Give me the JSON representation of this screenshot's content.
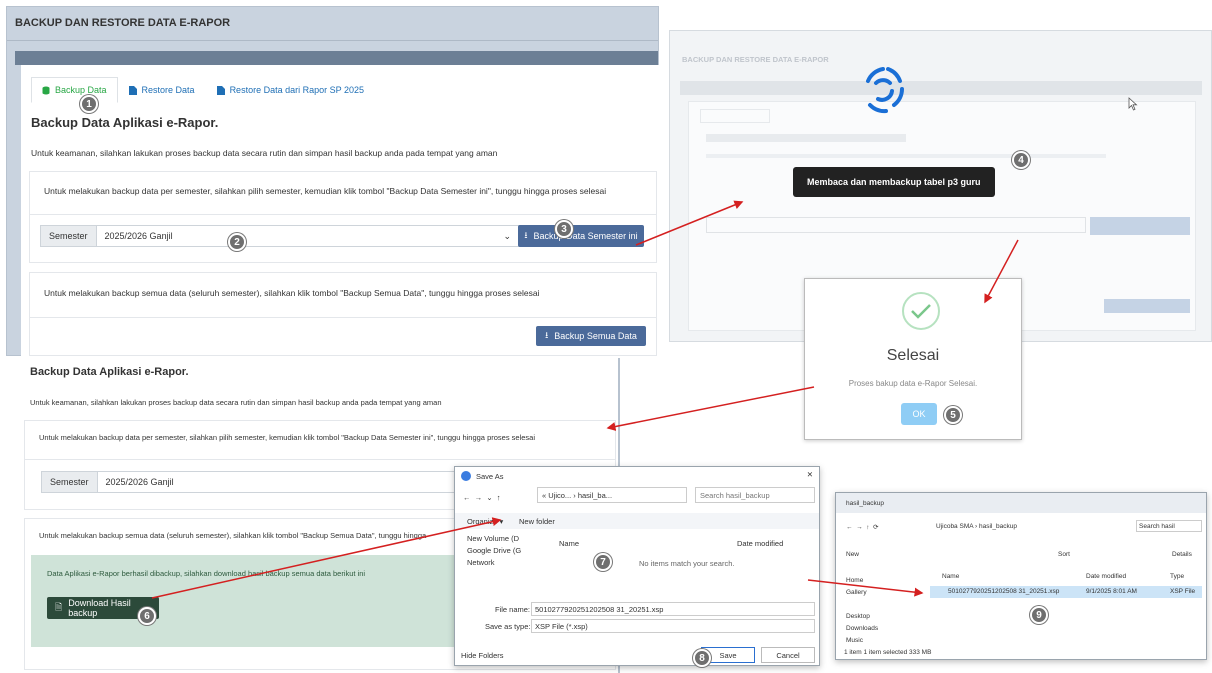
{
  "panel1": {
    "header": "BACKUP DAN RESTORE DATA E-RAPOR",
    "tabs": [
      {
        "label": "Backup Data"
      },
      {
        "label": "Restore Data"
      },
      {
        "label": "Restore Data dari Rapor SP 2025"
      }
    ],
    "title": "Backup Data Aplikasi e-Rapor.",
    "intro": "Untuk keamanan, silahkan lakukan proses backup data secara rutin dan simpan hasil backup anda pada tempat yang aman",
    "semester_note": "Untuk melakukan backup data per semester, silahkan pilih semester, kemudian klik tombol \"Backup Data Semester ini\", tunggu hingga proses selesai",
    "semester_label": "Semester",
    "semester_value": "2025/2026 Ganjil",
    "backup_semester_btn": "Backup Data Semester ini",
    "all_note": "Untuk melakukan backup semua data (seluruh semester), silahkan klik tombol \"Backup Semua Data\", tunggu hingga proses selesai",
    "backup_all_btn": "Backup Semua Data"
  },
  "panel2": {
    "header": "BACKUP DAN RESTORE DATA E-RAPOR",
    "tooltip": "Membaca dan membackup tabel p3 guru"
  },
  "dialog": {
    "title": "Selesai",
    "message": "Proses bakup data e-Rapor Selesai.",
    "ok": "OK"
  },
  "panel3": {
    "title": "Backup Data Aplikasi e-Rapor.",
    "intro": "Untuk keamanan, silahkan lakukan proses backup data secara rutin dan simpan hasil backup anda pada tempat yang aman",
    "semester_note": "Untuk melakukan backup data per semester, silahkan pilih semester, kemudian klik tombol \"Backup Data Semester ini\", tunggu hingga proses selesai",
    "semester_label": "Semester",
    "semester_value": "2025/2026 Ganjil",
    "all_note": "Untuk melakukan backup semua data (seluruh semester), silahkan klik tombol \"Backup Semua Data\", tunggu hingga",
    "success_msg": "Data Aplikasi e-Rapor berhasil dibackup, silahkan download hasil backup semua data berikut ini",
    "download_btn": "Download Hasil backup"
  },
  "save_as": {
    "title": "Save As",
    "path": "« Ujico... › hasil_ba...",
    "search_placeholder": "Search hasil_backup",
    "organize": "Organize ▾",
    "new_folder": "New folder",
    "nav_items": [
      "New Volume (D",
      "Google Drive (G",
      "Network"
    ],
    "col_name": "Name",
    "col_date": "Date modified",
    "empty": "No items match your search.",
    "file_name_label": "File name:",
    "file_name": "5010277920251202508 31_20251.xsp",
    "type_label": "Save as type:",
    "type_value": "XSP File (*.xsp)",
    "hide_folders": "Hide Folders",
    "save": "Save",
    "cancel": "Cancel"
  },
  "explorer": {
    "tab": "hasil_backup",
    "crumbs": [
      "Ujicoba SMA",
      "hasil_backup"
    ],
    "search": "Search hasil",
    "new": "New",
    "sort": "Sort",
    "details": "Details",
    "nav": [
      "Home",
      "Gallery",
      "Desktop",
      "Downloads",
      "Music"
    ],
    "cols": [
      "Name",
      "Date modified",
      "Type"
    ],
    "file": {
      "name": "5010277920251202508 31_20251.xsp",
      "date": "9/1/2025 8:01 AM",
      "type": "XSP File"
    },
    "status": "1 item    1 item selected  333 MB"
  },
  "badges": [
    "1",
    "2",
    "3",
    "4",
    "5",
    "6",
    "7",
    "8",
    "9"
  ]
}
